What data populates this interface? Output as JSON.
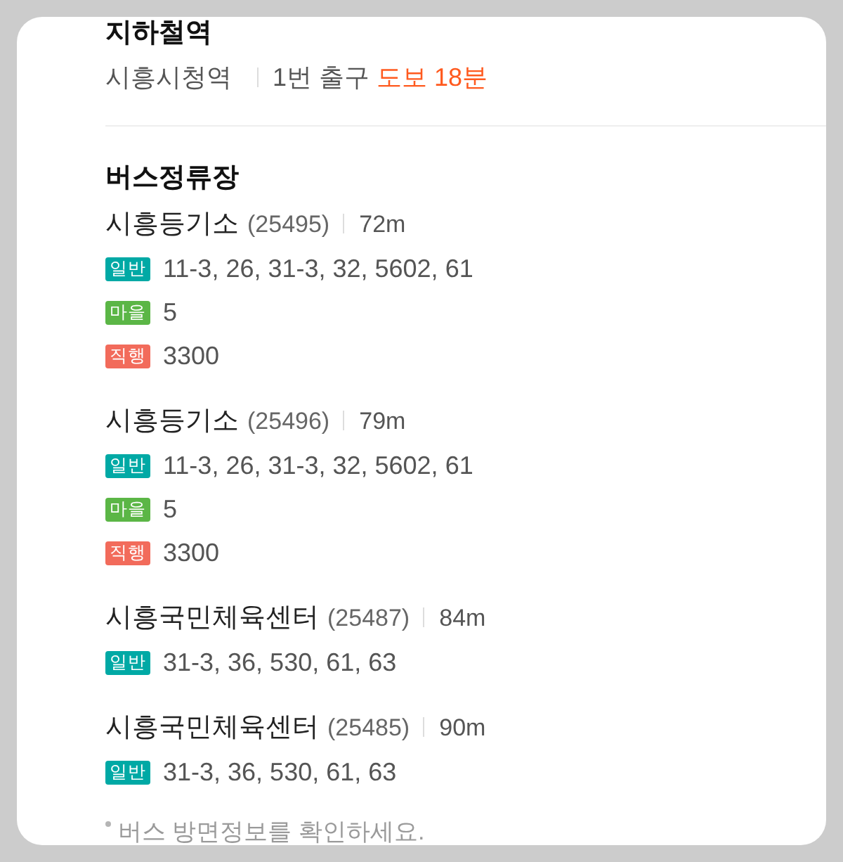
{
  "subway": {
    "title": "지하철역",
    "station": "시흥시청역",
    "exit": "1번 출구",
    "walk": "도보 18분"
  },
  "bus": {
    "title": "버스정류장",
    "stops": [
      {
        "name": "시흥등기소",
        "id": "(25495)",
        "distance": "72m",
        "routes": [
          {
            "label": "일반",
            "color": "#00a9a5",
            "numbers": "11-3, 26, 31-3, 32, 5602, 61"
          },
          {
            "label": "마을",
            "color": "#5bb646",
            "numbers": "5"
          },
          {
            "label": "직행",
            "color": "#f26b5b",
            "numbers": "3300"
          }
        ]
      },
      {
        "name": "시흥등기소",
        "id": "(25496)",
        "distance": "79m",
        "routes": [
          {
            "label": "일반",
            "color": "#00a9a5",
            "numbers": "11-3, 26, 31-3, 32, 5602, 61"
          },
          {
            "label": "마을",
            "color": "#5bb646",
            "numbers": "5"
          },
          {
            "label": "직행",
            "color": "#f26b5b",
            "numbers": "3300"
          }
        ]
      },
      {
        "name": "시흥국민체육센터",
        "id": "(25487)",
        "distance": "84m",
        "routes": [
          {
            "label": "일반",
            "color": "#00a9a5",
            "numbers": "31-3, 36, 530, 61, 63"
          }
        ]
      },
      {
        "name": "시흥국민체육센터",
        "id": "(25485)",
        "distance": "90m",
        "routes": [
          {
            "label": "일반",
            "color": "#00a9a5",
            "numbers": "31-3, 36, 530, 61, 63"
          }
        ]
      }
    ],
    "note": "버스 방면정보를 확인하세요."
  }
}
